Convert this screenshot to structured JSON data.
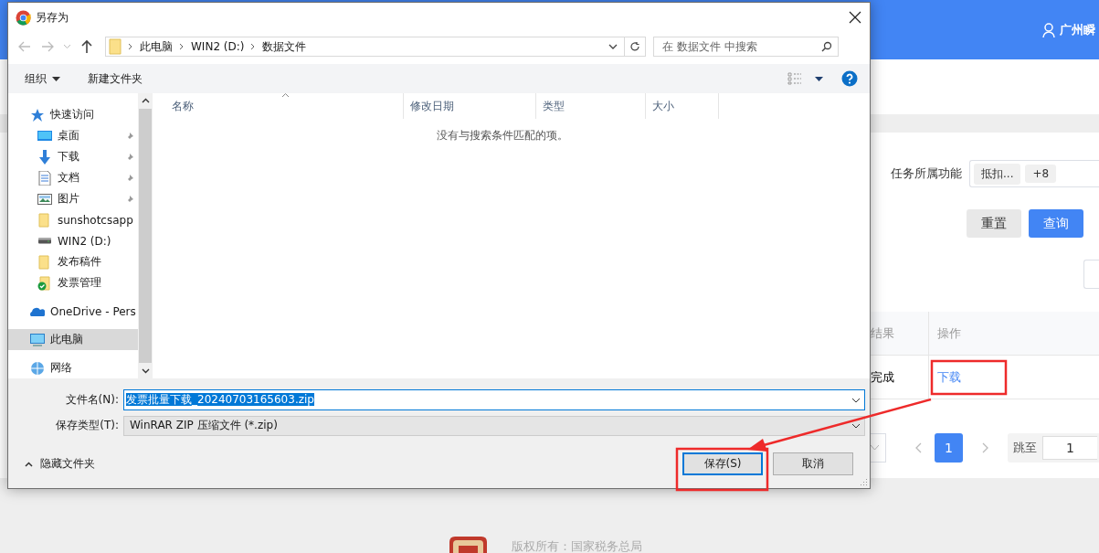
{
  "page": {
    "header": {
      "user_name": "广州瞬"
    },
    "filter": {
      "label": "任务所属功能",
      "tags": [
        "抵扣...",
        "+8"
      ]
    },
    "buttons": [
      {
        "label": "重置",
        "kind": "default"
      },
      {
        "label": "查询",
        "kind": "primary"
      }
    ],
    "table": {
      "columns": [
        "结果",
        "操作"
      ],
      "rows": [
        {
          "result": "完成",
          "action": "下载"
        }
      ]
    },
    "pagination": {
      "pages": [
        {
          "label": "1",
          "selected": true
        }
      ],
      "jump_label": "跳至",
      "jump_value": "1"
    },
    "footer": {
      "copyright": "版权所有：国家税务总局"
    }
  },
  "dialog": {
    "title": "另存为",
    "breadcrumb": [
      "此电脑",
      "WIN2 (D:)",
      "数据文件"
    ],
    "search_placeholder": "在 数据文件 中搜索",
    "toolbar": {
      "organize": "组织",
      "new_folder": "新建文件夹"
    },
    "nav_items": [
      {
        "label": "快速访问",
        "kind": "star",
        "selected": false,
        "children": [
          {
            "label": "桌面",
            "kind": "desktop",
            "pinned": true,
            "selected": false
          },
          {
            "label": "下载",
            "kind": "download",
            "pinned": true,
            "selected": false
          },
          {
            "label": "文档",
            "kind": "document",
            "pinned": true,
            "selected": false
          },
          {
            "label": "图片",
            "kind": "picture",
            "pinned": true,
            "selected": false
          },
          {
            "label": "sunshotcsapp",
            "kind": "folder",
            "pinned": false,
            "selected": false
          },
          {
            "label": "WIN2 (D:)",
            "kind": "drive",
            "pinned": false,
            "selected": false
          },
          {
            "label": "发布稿件",
            "kind": "folder",
            "pinned": false,
            "selected": false
          },
          {
            "label": "发票管理",
            "kind": "synced",
            "pinned": false,
            "selected": false
          }
        ]
      },
      {
        "label": "OneDrive - Pers",
        "kind": "cloud",
        "selected": false
      },
      {
        "label": "此电脑",
        "kind": "computer",
        "selected": true
      },
      {
        "label": "网络",
        "kind": "network",
        "selected": false
      }
    ],
    "columns": [
      "名称",
      "修改日期",
      "类型",
      "大小"
    ],
    "empty_message": "没有与搜索条件匹配的项。",
    "filename_label": "文件名(N):",
    "filename": "发票批量下载_20240703165603.zip",
    "filename_selected": true,
    "filetype_label": "保存类型(T):",
    "filetype": "WinRAR ZIP 压缩文件 (*.zip)",
    "hide_folders": "隐藏文件夹",
    "buttons": [
      {
        "label": "保存(S)",
        "default": true
      },
      {
        "label": "取消",
        "default": false
      }
    ]
  }
}
